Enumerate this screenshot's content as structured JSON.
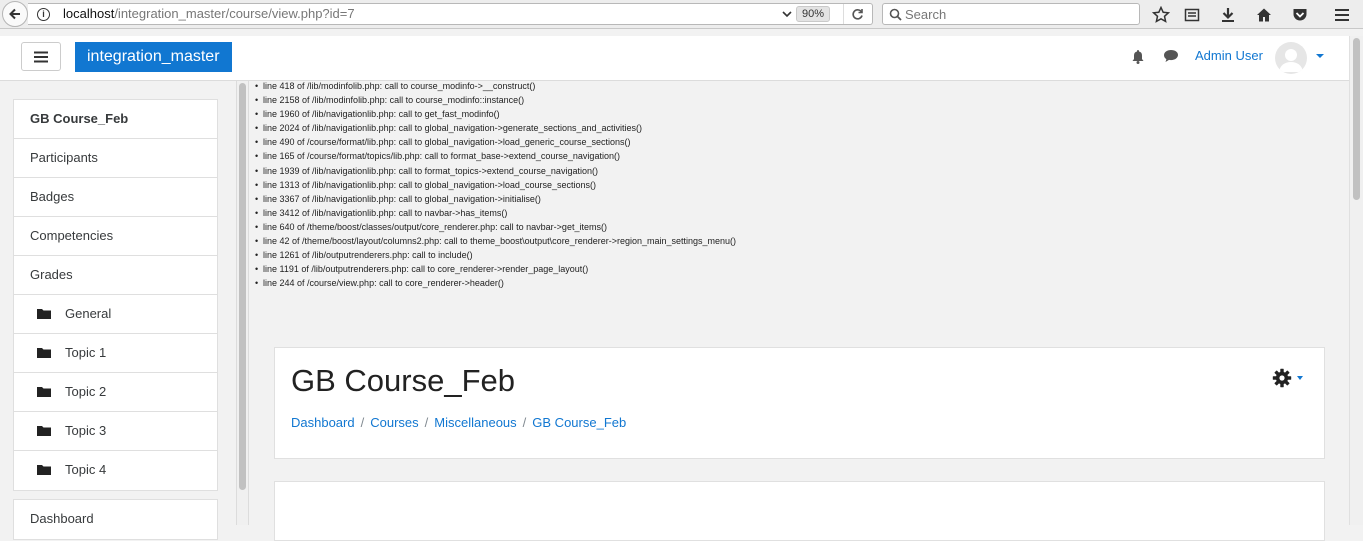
{
  "browser": {
    "url_host": "localhost",
    "url_path": "/integration_master/course/view.php?id=7",
    "zoom": "90%",
    "search_placeholder": "Search"
  },
  "navbar": {
    "site_name": "integration_master",
    "user_name": "Admin User"
  },
  "drawer": {
    "course_items": [
      {
        "label": "GB Course_Feb"
      },
      {
        "label": "Participants"
      },
      {
        "label": "Badges"
      },
      {
        "label": "Competencies"
      },
      {
        "label": "Grades"
      },
      {
        "label": "General"
      },
      {
        "label": "Topic 1"
      },
      {
        "label": "Topic 2"
      },
      {
        "label": "Topic 3"
      },
      {
        "label": "Topic 4"
      }
    ],
    "dashboard_label": "Dashboard"
  },
  "debug_trace": [
    "line 418 of /lib/modinfolib.php: call to course_modinfo->__construct()",
    "line 2158 of /lib/modinfolib.php: call to course_modinfo::instance()",
    "line 1960 of /lib/navigationlib.php: call to get_fast_modinfo()",
    "line 2024 of /lib/navigationlib.php: call to global_navigation->generate_sections_and_activities()",
    "line 490 of /course/format/lib.php: call to global_navigation->load_generic_course_sections()",
    "line 165 of /course/format/topics/lib.php: call to format_base->extend_course_navigation()",
    "line 1939 of /lib/navigationlib.php: call to format_topics->extend_course_navigation()",
    "line 1313 of /lib/navigationlib.php: call to global_navigation->load_course_sections()",
    "line 3367 of /lib/navigationlib.php: call to global_navigation->initialise()",
    "line 3412 of /lib/navigationlib.php: call to navbar->has_items()",
    "line 640 of /theme/boost/classes/output/core_renderer.php: call to navbar->get_items()",
    "line 42 of /theme/boost/layout/columns2.php: call to theme_boost\\output\\core_renderer->region_main_settings_menu()",
    "line 1261 of /lib/outputrenderers.php: call to include()",
    "line 1191 of /lib/outputrenderers.php: call to core_renderer->render_page_layout()",
    "line 244 of /course/view.php: call to core_renderer->header()"
  ],
  "header": {
    "title": "GB Course_Feb",
    "breadcrumb": [
      "Dashboard",
      "Courses",
      "Miscellaneous",
      "GB Course_Feb"
    ]
  },
  "colors": {
    "brand": "#1177d1",
    "background": "#f2f2f2"
  }
}
